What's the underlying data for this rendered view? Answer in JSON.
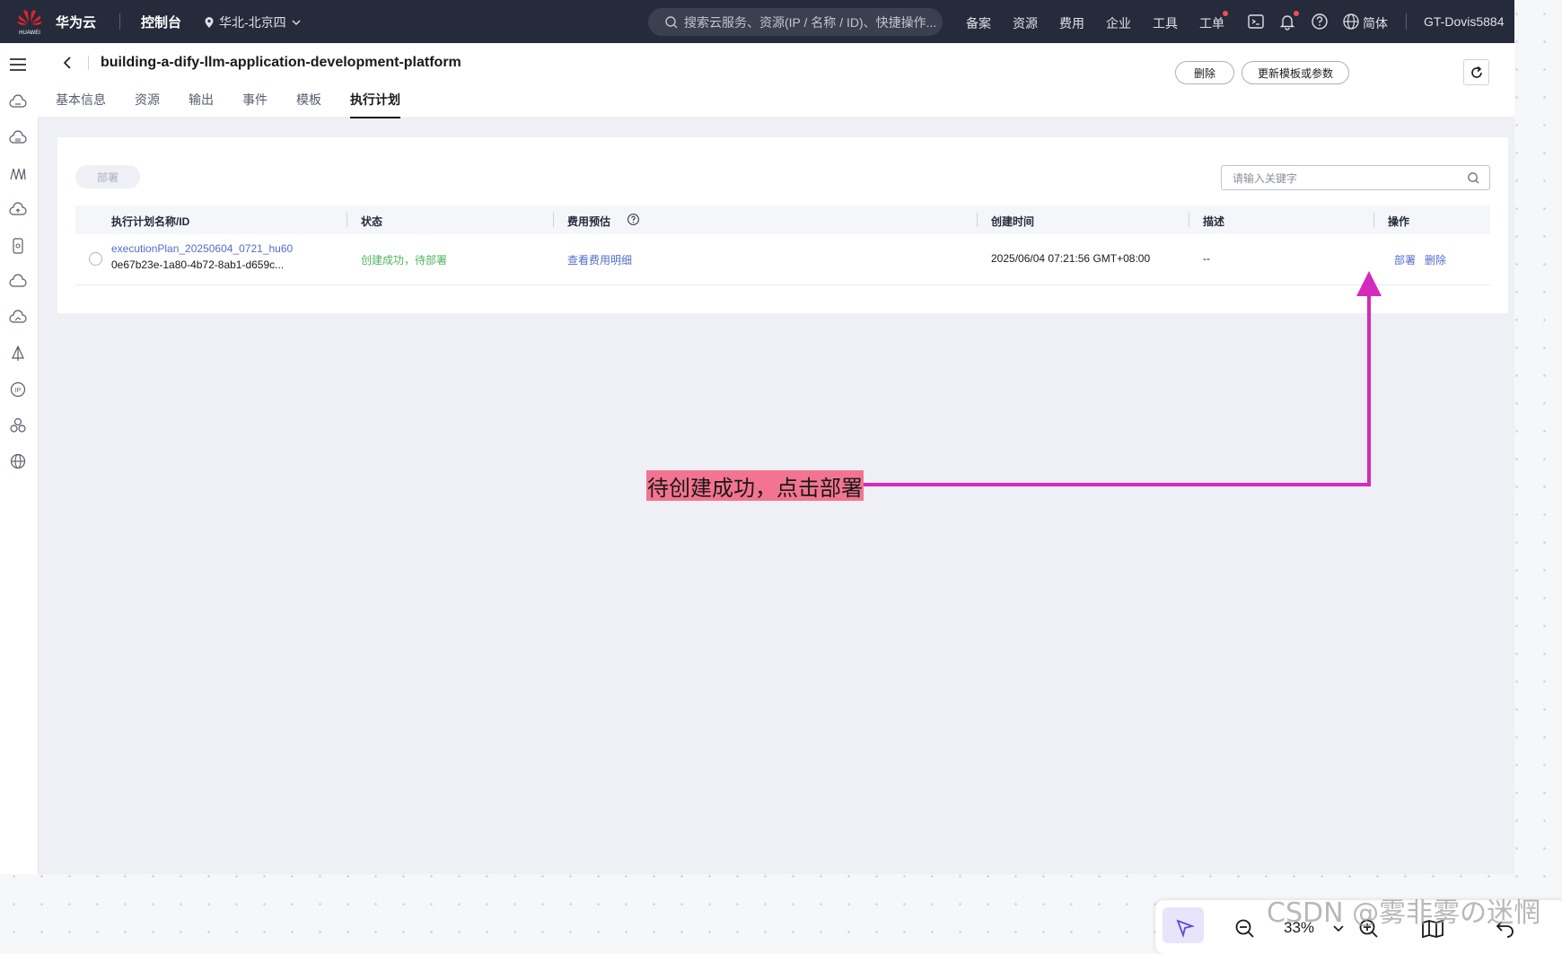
{
  "topbar": {
    "logo_text": "HUAWEI",
    "brand": "华为云",
    "console": "控制台",
    "region": "华北-北京四",
    "search_placeholder": "搜索云服务、资源(IP / 名称 / ID)、快捷操作...",
    "nav": [
      "备案",
      "资源",
      "费用",
      "企业",
      "工具",
      "工单"
    ],
    "language": "简体",
    "user": "GT-Dovis5884"
  },
  "header": {
    "title": "building-a-dify-llm-application-development-platform",
    "tabs": [
      {
        "label": "基本信息",
        "active": false
      },
      {
        "label": "资源",
        "active": false
      },
      {
        "label": "输出",
        "active": false
      },
      {
        "label": "事件",
        "active": false
      },
      {
        "label": "模板",
        "active": false
      },
      {
        "label": "执行计划",
        "active": true
      }
    ],
    "delete_label": "删除",
    "update_label": "更新模板或参数"
  },
  "card": {
    "deploy_label": "部署",
    "keyword_placeholder": "请输入关键字",
    "columns": [
      "执行计划名称/ID",
      "状态",
      "费用预估",
      "创建时间",
      "描述",
      "操作"
    ],
    "rows": [
      {
        "name": "executionPlan_20250604_0721_hu60",
        "id": "0e67b23e-1a80-4b72-8ab1-d659c...",
        "status": "创建成功，待部署",
        "cost": "查看费用明细",
        "created": "2025/06/04 07:21:56 GMT+08:00",
        "description": "--",
        "action_deploy": "部署",
        "action_delete": "删除"
      }
    ]
  },
  "annotation": "待创建成功，点击部署",
  "bottom_toolbar": {
    "zoom": "33%"
  },
  "watermark": "CSDN @雾非雾の迷惘",
  "colors": {
    "topbar": "#252b3a",
    "link": "#526ecc",
    "success": "#50b65a",
    "arrow": "#d42bbd",
    "note_bg": "#f37491"
  }
}
